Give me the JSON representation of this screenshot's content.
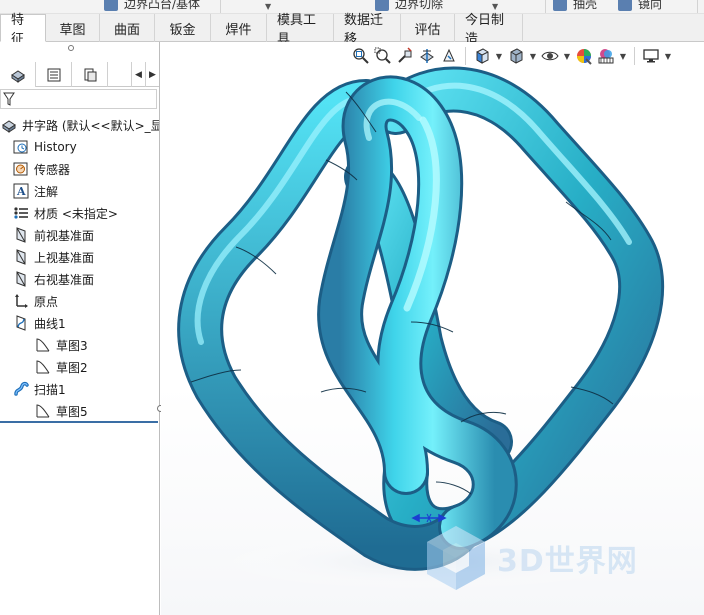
{
  "top_commands": [
    {
      "label": "边界凸台/基体"
    },
    {
      "label": "边界切除"
    },
    {
      "label": "抽壳"
    },
    {
      "label": "镜向"
    }
  ],
  "tabs": [
    {
      "label": "特征",
      "active": true
    },
    {
      "label": "草图"
    },
    {
      "label": "曲面"
    },
    {
      "label": "钣金"
    },
    {
      "label": "焊件"
    },
    {
      "label": "模具工具"
    },
    {
      "label": "数据迁移"
    },
    {
      "label": "评估"
    },
    {
      "label": "今日制造"
    }
  ],
  "panel_tabs": [
    {
      "icon": "feature-manager-icon"
    },
    {
      "icon": "property-manager-icon"
    },
    {
      "icon": "configuration-manager-icon"
    }
  ],
  "tree": {
    "root": "井字路 (默认<<默认>_显示",
    "items": [
      {
        "label": "History",
        "icon": "history-icon",
        "level": 1
      },
      {
        "label": "传感器",
        "icon": "sensor-icon",
        "level": 1
      },
      {
        "label": "注解",
        "icon": "annotation-icon",
        "level": 1
      },
      {
        "label": "材质 <未指定>",
        "icon": "material-icon",
        "level": 1
      },
      {
        "label": "前视基准面",
        "icon": "plane-icon",
        "level": 1
      },
      {
        "label": "上视基准面",
        "icon": "plane-icon",
        "level": 1
      },
      {
        "label": "右视基准面",
        "icon": "plane-icon",
        "level": 1
      },
      {
        "label": "原点",
        "icon": "origin-icon",
        "level": 1
      },
      {
        "label": "曲线1",
        "icon": "curve-icon",
        "level": 1
      },
      {
        "label": "草图3",
        "icon": "sketch-icon",
        "level": 2
      },
      {
        "label": "草图2",
        "icon": "sketch-icon",
        "level": 2
      },
      {
        "label": "扫描1",
        "icon": "sweep-icon",
        "level": 1
      },
      {
        "label": "草图5",
        "icon": "sketch-icon",
        "level": 2
      }
    ]
  },
  "colors": {
    "tube": "#2bb8cf",
    "tube_highlight": "#8ff0ff",
    "tube_shadow": "#1d5f86",
    "selection": "#1b3fd1"
  },
  "watermark": {
    "text": "3D世界网"
  }
}
